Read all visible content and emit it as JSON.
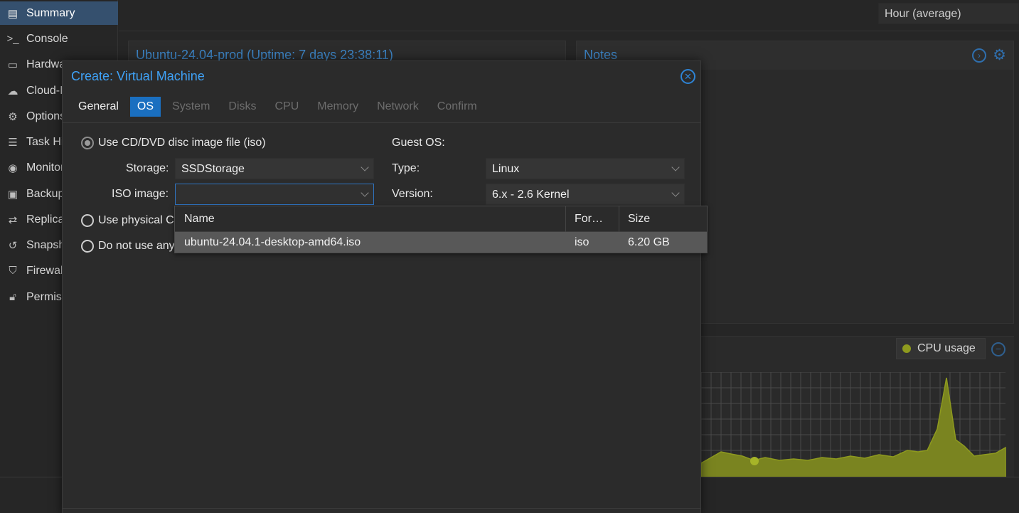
{
  "sidebar": {
    "items": [
      {
        "label": "Summary",
        "icon": "book-icon",
        "active": true
      },
      {
        "label": "Console",
        "icon": "terminal-icon"
      },
      {
        "label": "Hardware",
        "icon": "monitor-icon"
      },
      {
        "label": "Cloud-Init",
        "icon": "cloud-icon"
      },
      {
        "label": "Options",
        "icon": "gear-icon"
      },
      {
        "label": "Task History",
        "icon": "list-icon"
      },
      {
        "label": "Monitor",
        "icon": "eye-icon"
      },
      {
        "label": "Backup",
        "icon": "floppy-icon"
      },
      {
        "label": "Replication",
        "icon": "retweet-icon"
      },
      {
        "label": "Snapshots",
        "icon": "history-icon"
      },
      {
        "label": "Firewall",
        "icon": "shield-icon"
      },
      {
        "label": "Permissions",
        "icon": "unlock-icon"
      }
    ]
  },
  "topbar": {
    "timeframe": "Hour (average)"
  },
  "status_panel": {
    "title": "Ubuntu-24.04-prod (Uptime: 7 days 23:38:11)"
  },
  "notes_panel": {
    "title": "Notes"
  },
  "cpu_panel": {
    "legend_label": "CPU usage",
    "series_color": "#8e9a1e"
  },
  "dialog": {
    "title": "Create: Virtual Machine",
    "tabs": [
      {
        "label": "General",
        "state": "done"
      },
      {
        "label": "OS",
        "state": "active"
      },
      {
        "label": "System",
        "state": "disabled"
      },
      {
        "label": "Disks",
        "state": "disabled"
      },
      {
        "label": "CPU",
        "state": "disabled"
      },
      {
        "label": "Memory",
        "state": "disabled"
      },
      {
        "label": "Network",
        "state": "disabled"
      },
      {
        "label": "Confirm",
        "state": "disabled"
      }
    ],
    "media": {
      "opt_iso": "Use CD/DVD disc image file (iso)",
      "opt_physical": "Use physical CD/DVD Drive",
      "opt_none": "Do not use any media",
      "storage_label": "Storage:",
      "storage_value": "SSDStorage",
      "iso_label": "ISO image:",
      "iso_value": ""
    },
    "guest": {
      "heading": "Guest OS:",
      "type_label": "Type:",
      "type_value": "Linux",
      "version_label": "Version:",
      "version_value": "6.x - 2.6 Kernel"
    },
    "iso_picker": {
      "columns": [
        "Name",
        "For…",
        "Size"
      ],
      "rows": [
        {
          "name": "ubuntu-24.04.1-desktop-amd64.iso",
          "format": "iso",
          "size": "6.20 GB"
        }
      ]
    }
  },
  "colors": {
    "accent": "#3fa2f7",
    "active_tab": "#1a6fc0",
    "selection": "#35506e"
  }
}
